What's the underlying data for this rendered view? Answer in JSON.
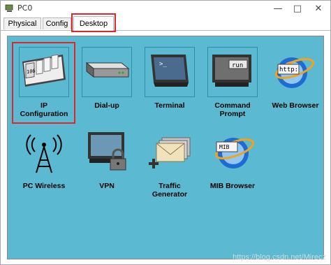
{
  "window": {
    "title": "PC0"
  },
  "tabs": [
    {
      "label": "Physical"
    },
    {
      "label": "Config"
    },
    {
      "label": "Desktop"
    }
  ],
  "apps": [
    {
      "label": "IP\nConfiguration",
      "icon": "ip-config-icon",
      "badge": "106"
    },
    {
      "label": "Dial-up",
      "icon": "modem-icon"
    },
    {
      "label": "Terminal",
      "icon": "terminal-icon",
      "prompt": ">_"
    },
    {
      "label": "Command\nPrompt",
      "icon": "command-prompt-icon",
      "text": "run"
    },
    {
      "label": "Web Browser",
      "icon": "web-browser-icon",
      "text": "http:"
    },
    {
      "label": "PC Wireless",
      "icon": "wireless-antenna-icon"
    },
    {
      "label": "VPN",
      "icon": "vpn-lock-icon"
    },
    {
      "label": "Traffic\nGenerator",
      "icon": "traffic-generator-icon"
    },
    {
      "label": "MIB Browser",
      "icon": "mib-browser-icon",
      "text": "MIB"
    }
  ],
  "watermark": "https://blog.csdn.net/Mirecz"
}
